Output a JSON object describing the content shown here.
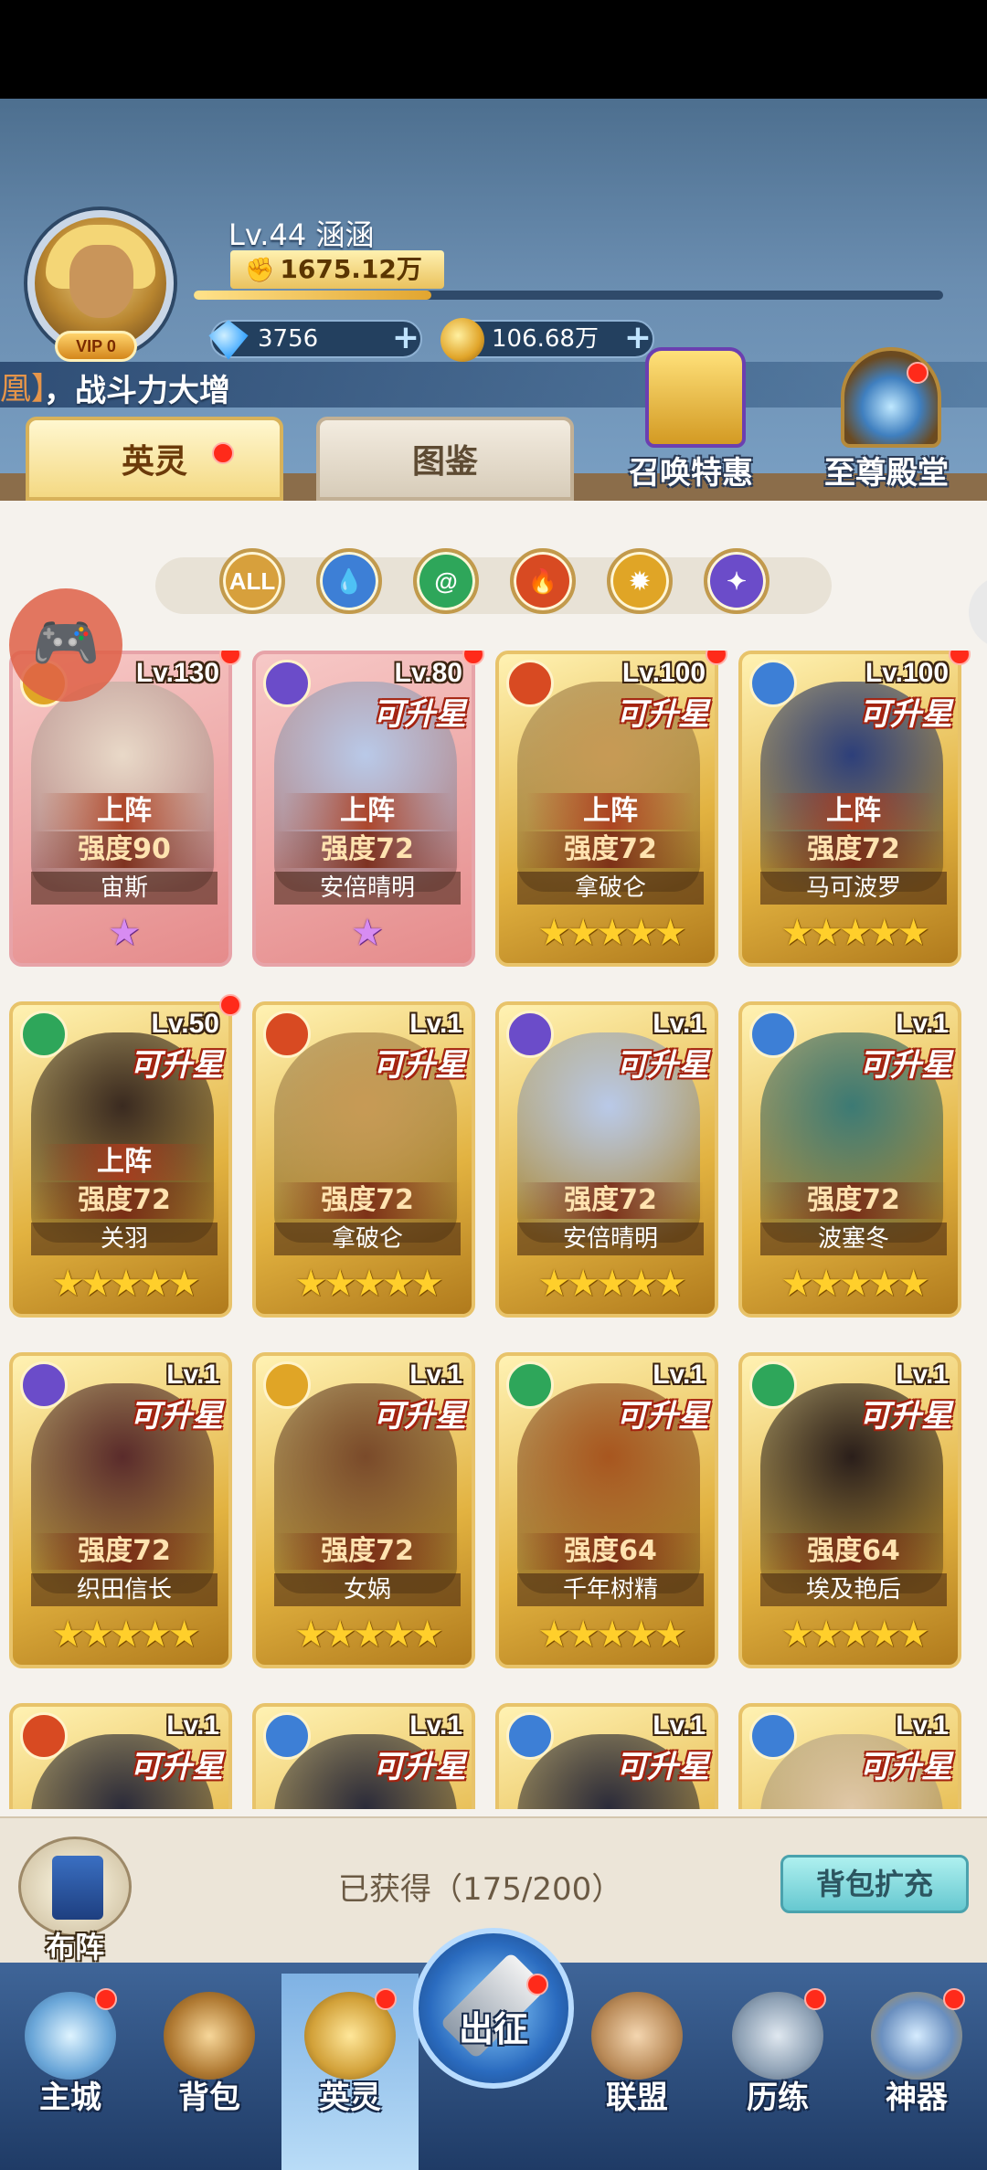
{
  "player": {
    "level_name": "Lv.44   涵涵",
    "vip": "VIP 0",
    "power": "1675.12万"
  },
  "currency": {
    "diamonds": "3756",
    "gold": "106.68万",
    "plus": "+"
  },
  "ticker": {
    "bracket": "凰】",
    "message": "，战斗力大增"
  },
  "shortcuts": {
    "summon_offer": "召唤特惠",
    "supreme_hall": "至尊殿堂"
  },
  "tabs": {
    "heroes": "英灵",
    "gallery": "图鉴"
  },
  "filters": [
    "ALL",
    "water",
    "wind",
    "fire",
    "light",
    "dark"
  ],
  "hero_labels": {
    "upgrade": "可升星",
    "deployed": "上阵"
  },
  "heroes": [
    {
      "name": "宙斯",
      "level": "Lv.130",
      "strength": "强度90",
      "deployed": true,
      "upgradable": false,
      "stars": "★",
      "star_color": "purple",
      "element": "light",
      "bg": "pink"
    },
    {
      "name": "安倍晴明",
      "level": "Lv.80",
      "strength": "强度72",
      "deployed": true,
      "upgradable": true,
      "stars": "★",
      "star_color": "purple",
      "element": "dark",
      "bg": "pink"
    },
    {
      "name": "拿破仑",
      "level": "Lv.100",
      "strength": "强度72",
      "deployed": true,
      "upgradable": true,
      "stars": "★★★★★",
      "star_color": "gold",
      "element": "fire",
      "bg": "gold"
    },
    {
      "name": "马可波罗",
      "level": "Lv.100",
      "strength": "强度72",
      "deployed": true,
      "upgradable": true,
      "stars": "★★★★★",
      "star_color": "gold",
      "element": "water",
      "bg": "gold"
    },
    {
      "name": "关羽",
      "level": "Lv.50",
      "strength": "强度72",
      "deployed": true,
      "upgradable": true,
      "stars": "★★★★★",
      "star_color": "gold",
      "element": "wind",
      "bg": "gold"
    },
    {
      "name": "拿破仑",
      "level": "Lv.1",
      "strength": "强度72",
      "deployed": false,
      "upgradable": true,
      "stars": "★★★★★",
      "star_color": "gold",
      "element": "fire",
      "bg": "gold"
    },
    {
      "name": "安倍晴明",
      "level": "Lv.1",
      "strength": "强度72",
      "deployed": false,
      "upgradable": true,
      "stars": "★★★★★",
      "star_color": "gold",
      "element": "dark",
      "bg": "gold"
    },
    {
      "name": "波塞冬",
      "level": "Lv.1",
      "strength": "强度72",
      "deployed": false,
      "upgradable": true,
      "stars": "★★★★★",
      "star_color": "gold",
      "element": "water",
      "bg": "gold"
    },
    {
      "name": "织田信长",
      "level": "Lv.1",
      "strength": "强度72",
      "deployed": false,
      "upgradable": true,
      "stars": "★★★★★",
      "star_color": "gold",
      "element": "dark",
      "bg": "gold"
    },
    {
      "name": "女娲",
      "level": "Lv.1",
      "strength": "强度72",
      "deployed": false,
      "upgradable": true,
      "stars": "★★★★★",
      "star_color": "gold",
      "element": "light",
      "bg": "gold"
    },
    {
      "name": "千年树精",
      "level": "Lv.1",
      "strength": "强度64",
      "deployed": false,
      "upgradable": true,
      "stars": "★★★★★",
      "star_color": "gold",
      "element": "wind",
      "bg": "gold"
    },
    {
      "name": "埃及艳后",
      "level": "Lv.1",
      "strength": "强度64",
      "deployed": false,
      "upgradable": true,
      "stars": "★★★★★",
      "star_color": "gold",
      "element": "wind",
      "bg": "gold"
    },
    {
      "name": "",
      "level": "Lv.1",
      "strength": "",
      "deployed": false,
      "upgradable": true,
      "stars": "",
      "star_color": "gold",
      "element": "fire",
      "bg": "gold"
    },
    {
      "name": "",
      "level": "Lv.1",
      "strength": "",
      "deployed": false,
      "upgradable": true,
      "stars": "",
      "star_color": "gold",
      "element": "water",
      "bg": "gold"
    },
    {
      "name": "",
      "level": "Lv.1",
      "strength": "",
      "deployed": false,
      "upgradable": true,
      "stars": "",
      "star_color": "gold",
      "element": "water",
      "bg": "gold"
    },
    {
      "name": "",
      "level": "Lv.1",
      "strength": "",
      "deployed": false,
      "upgradable": true,
      "stars": "",
      "star_color": "gold",
      "element": "water",
      "bg": "gold"
    }
  ],
  "collection": {
    "owned": "已获得（175/200）",
    "expand": "背包扩充",
    "formation": "布阵"
  },
  "nav": {
    "city": "主城",
    "bag": "背包",
    "heroes": "英灵",
    "expedition": "出征",
    "alliance": "联盟",
    "trials": "历练",
    "artifact": "神器"
  },
  "colors": {
    "fire": "#d84a22",
    "water": "#3d7fd6",
    "wind": "#2ea65a",
    "light": "#e0a526",
    "dark": "#6b4cc9",
    "all": "#d7a03c"
  }
}
